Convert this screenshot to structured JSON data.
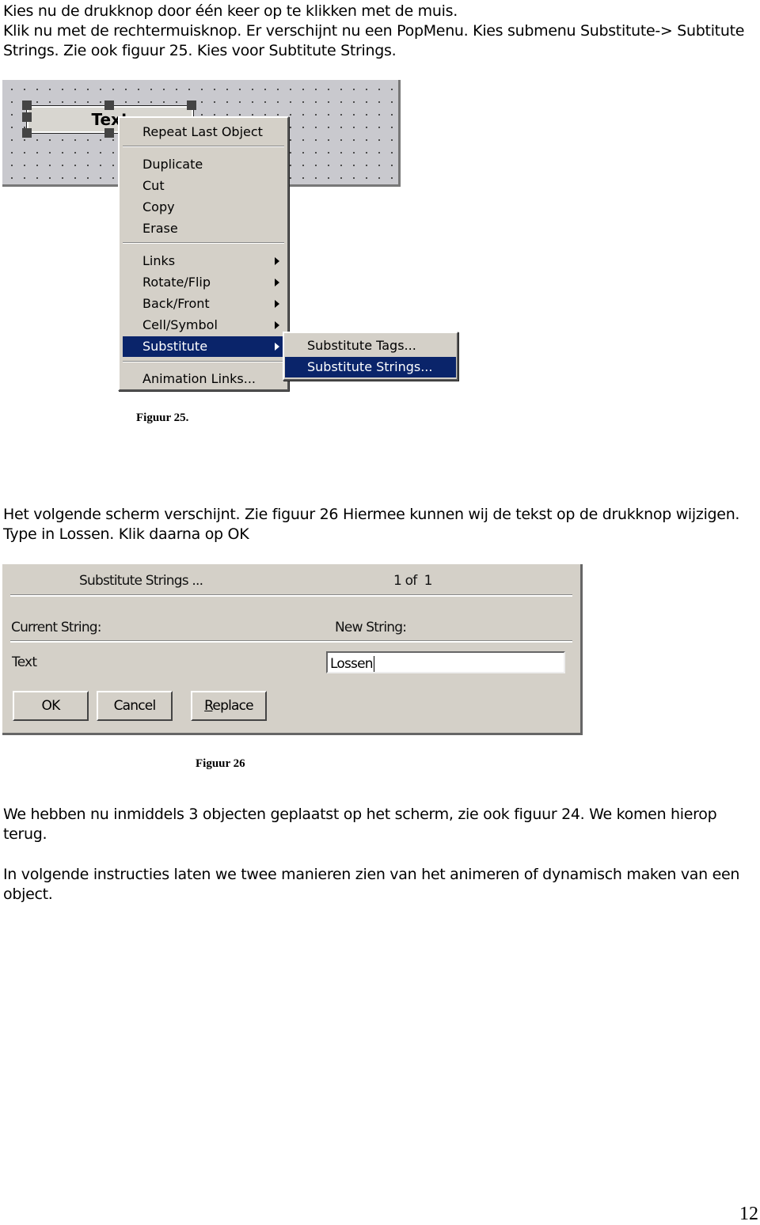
{
  "intro": {
    "lines": [
      "Kies nu de drukknop door één keer op te klikken met de muis.",
      "Klik nu met de rechtermuisknop. Er verschijnt nu een PopMenu. Kies submenu Substitute-> Subtitute",
      "Strings. Zie ook figuur 25. Kies voor Subtitute Strings."
    ]
  },
  "figure25": {
    "button_text": "Text",
    "menu_items": [
      {
        "label": "Repeat Last Object"
      },
      {
        "label": "Duplicate"
      },
      {
        "label": "Cut"
      },
      {
        "label": "Copy"
      },
      {
        "label": "Erase"
      },
      {
        "label": "Links",
        "submenu": true
      },
      {
        "label": "Rotate/Flip",
        "submenu": true
      },
      {
        "label": "Back/Front",
        "submenu": true
      },
      {
        "label": "Cell/Symbol",
        "submenu": true
      },
      {
        "label": "Substitute",
        "submenu": true,
        "highlighted": true
      },
      {
        "label": "Animation Links..."
      }
    ],
    "submenu_items": [
      {
        "label": "Substitute Tags..."
      },
      {
        "label": "Substitute Strings...",
        "highlighted": true
      }
    ],
    "highlight_color": "#0a246a",
    "caption": "Figuur 25."
  },
  "middle": {
    "lines": [
      "Het volgende scherm verschijnt. Zie figuur 26 Hiermee kunnen wij de tekst op de drukknop wijzigen.",
      "Type in Lossen. Klik daarna op OK"
    ]
  },
  "figure26": {
    "title": "Substitute Strings ...",
    "counter": "1 of  1",
    "current_label": "Current String:",
    "new_label": "New String:",
    "current_value": "Text",
    "new_value": "Lossen",
    "ok": "OK",
    "cancel": "Cancel",
    "replace_first": "R",
    "replace_rest": "eplace",
    "caption": "Figuur 26"
  },
  "outro": {
    "lines": [
      "We hebben nu inmiddels 3 objecten geplaatst op het scherm, zie ook figuur 24. We komen hierop",
      "terug.",
      "In volgende instructies laten we twee manieren zien van het animeren of dynamisch maken van een",
      "object."
    ]
  },
  "page_number": "12"
}
